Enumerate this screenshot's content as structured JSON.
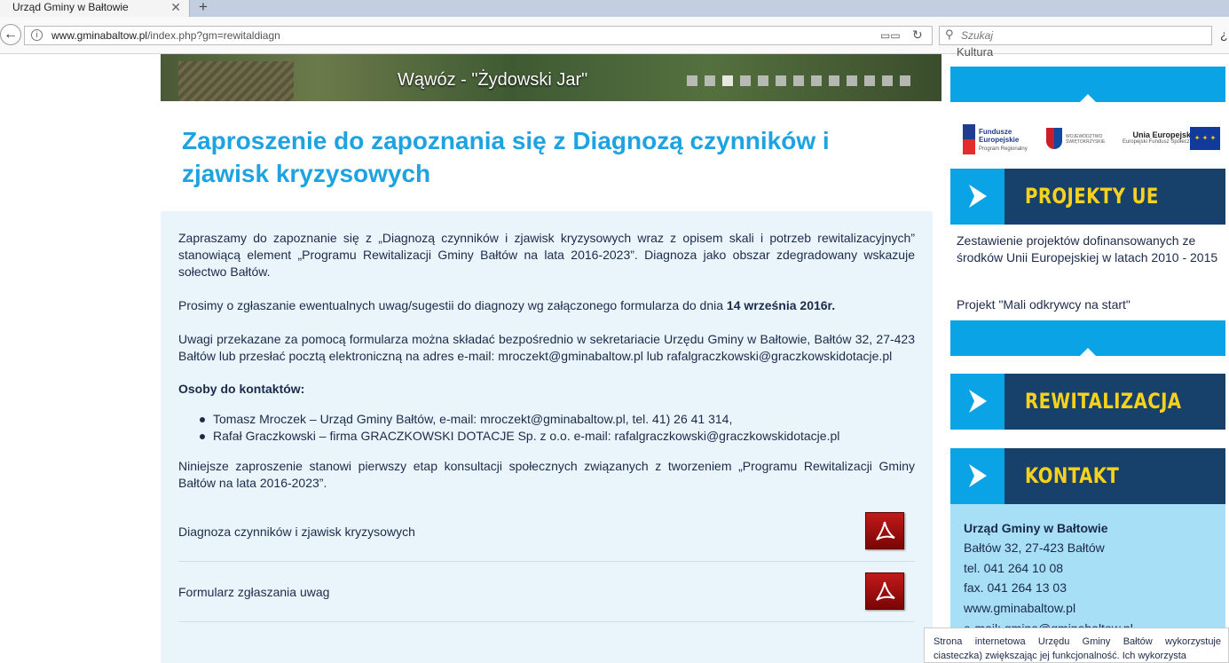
{
  "browser": {
    "tab_title": "Urząd Gminy w Bałtowie",
    "tab_close": "✕",
    "new_tab": "+",
    "url_host": "www.gminabaltow.pl",
    "url_path": "/index.php?gm=rewitaldiagn",
    "search_placeholder": "Szukaj"
  },
  "banner": {
    "caption": "Wąwóz - \"Żydowski Jar\"",
    "slide_count": 13,
    "active_slide": 2
  },
  "article": {
    "title": "Zaproszenie do zapoznania się z Diagnozą czynników i zjawisk kryzysowych",
    "p1": "Zapraszamy do zapoznanie się z „Diagnozą czynników i zjawisk kryzysowych wraz z opisem skali i potrzeb rewitalizacyjnych” stanowiącą element „Programu Rewitalizacji Gminy Bałtów na lata 2016-2023”. Diagnoza jako obszar zdegradowany wskazuje sołectwo Bałtów.",
    "p2_text": "Prosimy o zgłaszanie ewentualnych uwag/sugestii do diagnozy wg załączonego formularza do dnia ",
    "p2_bold": "14 września 2016r.",
    "p3": "Uwagi przekazane za pomocą formularza można składać bezpośrednio w sekretariacie Urzędu Gminy w Bałtowie, Bałtów 32, 27-423 Bałtów lub przesłać pocztą elektroniczną na adres e-mail: mroczekt@gminabaltow.pl lub rafalgraczkowski@graczkowskidotacje.pl",
    "contacts_label": "Osoby do kontaktów:",
    "contacts": [
      "Tomasz Mroczek – Urząd Gminy Bałtów, e-mail: mroczekt@gminabaltow.pl, tel. 41) 26 41 314,",
      "Rafał Graczkowski – firma GRACZKOWSKI DOTACJE Sp. z o.o. e-mail: rafalgraczkowski@graczkowskidotacje.pl"
    ],
    "p4": "Niniejsze zaproszenie stanowi pierwszy etap konsultacji społecznych związanych z tworzeniem „Programu Rewitalizacji Gminy Bałtów na lata 2016-2023”.",
    "documents": [
      {
        "label": "Diagnoza czynników i zjawisk kryzysowych"
      },
      {
        "label": "Formularz zgłaszania uwag"
      }
    ]
  },
  "sidebar": {
    "top_text": "Kultura",
    "logos": {
      "fe_title": "Fundusze\nEuropejskie",
      "fe_sub": "Program Regionalny",
      "region": "WOJEWÓDZTWO\nŚWIĘTOKRZYSKIE",
      "ue_title": "Unia Europejska",
      "ue_sub": "Europejski Fundusz Społeczny"
    },
    "projects_head": "PROJEKTY UE",
    "projects_links": [
      "Zestawienie projektów dofinansowanych ze środków Unii Europejskiej w latach 2010 - 2015",
      "Projekt \"Mali odkrywcy na start\""
    ],
    "rewitalizacja_head": "REWITALIZACJA",
    "kontakt_head": "KONTAKT",
    "contact": {
      "name": "Urząd Gminy w Bałtowie",
      "address": "Bałtów 32, 27-423 Bałtów",
      "tel": "tel. 041 264 10 08",
      "fax": "fax. 041 264 13 03",
      "www": "www.gminabaltow.pl",
      "email": "e-mail: gmina@gminabaltow.pl"
    }
  },
  "cookie_notice": "Strona internetowa Urzędu Gminy Bałtów wykorzystuje ciasteczka) zwiększając jej funkcjonalność. Ich wykorzysta"
}
